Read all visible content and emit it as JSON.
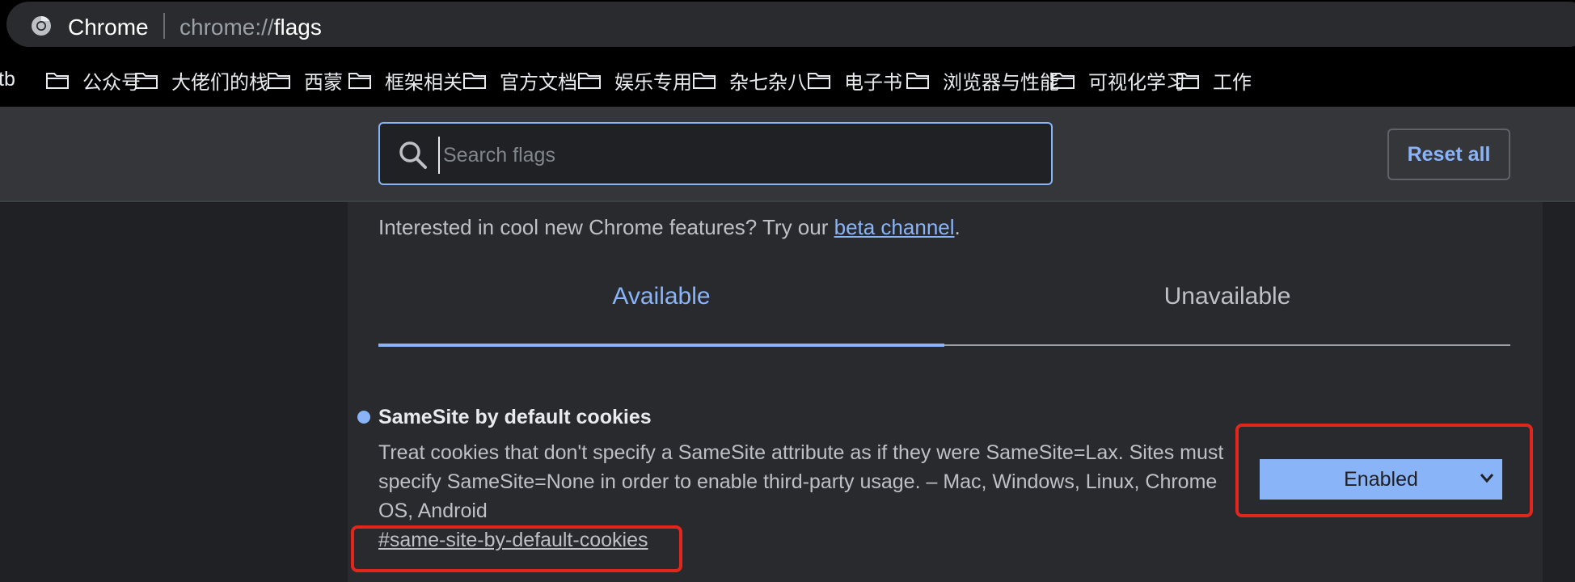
{
  "browser": {
    "site_name": "Chrome",
    "url_prefix": "chrome://",
    "url_path": "flags"
  },
  "bookmarks": {
    "partial_label": "tb",
    "items": [
      {
        "label": "公众号",
        "icon": "folder-icon"
      },
      {
        "label": "大佬们的栈",
        "icon": "folder-icon"
      },
      {
        "label": "西蒙",
        "icon": "folder-icon"
      },
      {
        "label": "框架相关",
        "icon": "folder-icon"
      },
      {
        "label": "官方文档",
        "icon": "folder-icon"
      },
      {
        "label": "娱乐专用",
        "icon": "folder-icon"
      },
      {
        "label": "杂七杂八",
        "icon": "folder-icon"
      },
      {
        "label": "电子书",
        "icon": "folder-icon"
      },
      {
        "label": "浏览器与性能",
        "icon": "folder-icon"
      },
      {
        "label": "可视化学习",
        "icon": "folder-icon"
      },
      {
        "label": "工作",
        "icon": "folder-icon"
      }
    ]
  },
  "header": {
    "search_placeholder": "Search flags",
    "reset_label": "Reset all"
  },
  "intro": {
    "text": "Interested in cool new Chrome features? Try our ",
    "link_text": "beta channel",
    "suffix": "."
  },
  "tabs": [
    {
      "label": "Available",
      "active": true
    },
    {
      "label": "Unavailable",
      "active": false
    }
  ],
  "experiment": {
    "title": "SameSite by default cookies",
    "description": "Treat cookies that don't specify a SameSite attribute as if they were SameSite=Lax. Sites must specify SameSite=None in order to enable third-party usage. – Mac, Windows, Linux, Chrome OS, Android",
    "link": "#same-site-by-default-cookies",
    "selected": "Enabled"
  },
  "colors": {
    "accent": "#8ab4f8",
    "annotation": "#e3261b",
    "background": "#202124"
  }
}
